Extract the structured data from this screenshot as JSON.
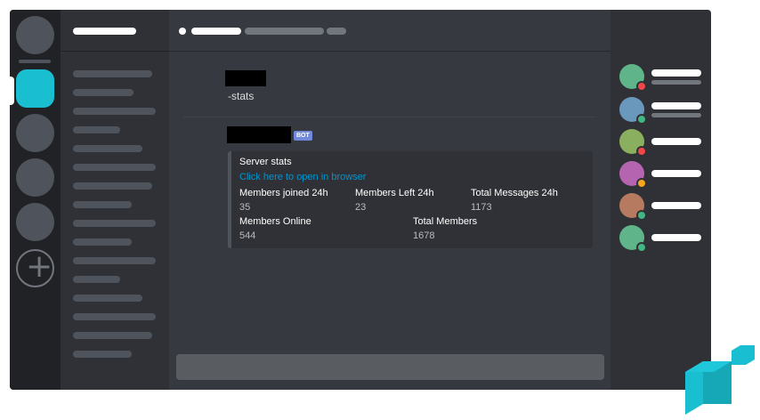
{
  "messages": [
    {
      "author_redacted": true,
      "content": "-stats"
    },
    {
      "author_redacted": true,
      "bot_tag": "BOT",
      "embed": {
        "title": "Server stats",
        "link": "Click here to open in browser",
        "fields_row1": [
          {
            "name": "Members joined 24h",
            "value": "35"
          },
          {
            "name": "Members Left 24h",
            "value": "23"
          },
          {
            "name": "Total Messages 24h",
            "value": "1173"
          }
        ],
        "fields_row2": [
          {
            "name": "Members Online",
            "value": "544"
          },
          {
            "name": "Total Members",
            "value": "1678"
          }
        ]
      }
    }
  ],
  "colors": {
    "accent": "#19bfd0",
    "bot_tag": "#7289da",
    "link": "#0096cf",
    "status_dnd": "#f04747",
    "status_online": "#43b581",
    "status_idle": "#faa61a"
  },
  "members": [
    {
      "avatar_color": "#5fb48a",
      "status": "dnd"
    },
    {
      "avatar_color": "#6a98bd",
      "status": "online"
    },
    {
      "avatar_color": "#8aaf5f",
      "status": "dnd"
    },
    {
      "avatar_color": "#b565b0",
      "status": "idle"
    },
    {
      "avatar_color": "#b57a5f",
      "status": "online"
    },
    {
      "avatar_color": "#5fb48a",
      "status": "online"
    }
  ],
  "icons": {
    "add_server": "plus-icon",
    "logo": "cube-logo"
  }
}
